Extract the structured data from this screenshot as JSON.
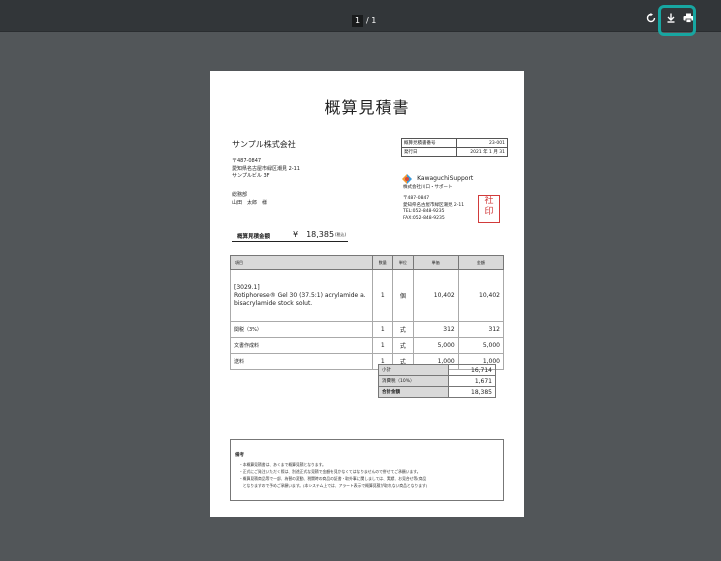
{
  "toolbar": {
    "current_page": "1",
    "page_sep_total": "/ 1",
    "rotate_icon": "rotate-icon",
    "download_icon": "download-icon",
    "print_icon": "print-icon",
    "highlight_color": "#17a6a1"
  },
  "doc": {
    "title": "概算見積書",
    "customer": {
      "company": "サンプル株式会社",
      "zip": "〒487-0847",
      "addr1": "愛知県名古屋市緑区潮見 2-11",
      "addr2": "サンプルビル 3F",
      "dept": "総務部",
      "person": "山田　太郎　様"
    },
    "meta_rows": [
      {
        "label": "概算見積書番号",
        "value": "23-001"
      },
      {
        "label": "発行日",
        "value": "2021 年 1 月 31"
      }
    ],
    "supplier": {
      "logo_text": "KawaguchiSupport",
      "name": "株式会社川口・サポート",
      "zip": "〒487-0847",
      "addr": "愛知県名古屋市緑区潮見 2-11",
      "tel": "TEL:052-848-9235",
      "fax": "FAX:052-848-9235",
      "stamp_line1": "社",
      "stamp_line2": "印"
    },
    "total_box": {
      "label": "概算見積金額",
      "value": "¥　18,385",
      "tax": "(税込)"
    },
    "items_headers": [
      "項目",
      "数量",
      "単位",
      "単価",
      "金額"
    ],
    "items": [
      {
        "code": "[3029.1]",
        "name1": "Rotiphorese® Gel 30 (37.5:1) acrylamide a.",
        "name2": "bisacrylamide stock solut.",
        "qty": "1",
        "unit": "個",
        "price": "10,402",
        "amount": "10,402"
      },
      {
        "name1": "関税（3%）",
        "qty": "1",
        "unit": "式",
        "price": "312",
        "amount": "312"
      },
      {
        "name1": "文書作成料",
        "qty": "1",
        "unit": "式",
        "price": "5,000",
        "amount": "5,000"
      },
      {
        "name1": "送料",
        "qty": "1",
        "unit": "式",
        "price": "1,000",
        "amount": "1,000"
      }
    ],
    "summary": [
      {
        "label": "小計",
        "value": "16,714"
      },
      {
        "label": "消費税（10%）",
        "value": "1,671"
      },
      {
        "label": "合計金額",
        "value": "18,385"
      }
    ],
    "notes": {
      "heading": "備考",
      "lines": [
        "・本概算見積書は、あくまで概算見積となります。",
        "・正式にご発注いただく際は、別途正式な見積で金額を見かなくてはなりませんので併せてご承願います。",
        "・概算見積商品等で一部、為替の変動、税関時の商品の証書・取外事に関しましては、実績、お見合せ等(商品",
        "　となりますので予めご承願います。(本システム上では、アラート表示で概算見積が取れない商品となります)"
      ]
    }
  }
}
